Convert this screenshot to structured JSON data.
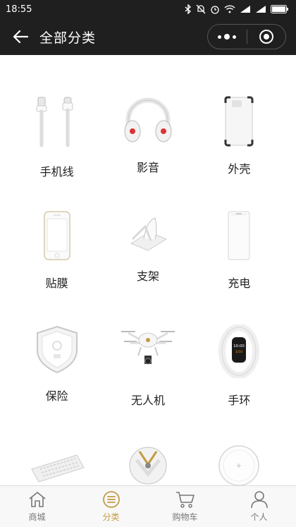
{
  "status_bar": {
    "time": "18:55"
  },
  "nav": {
    "title": "全部分类"
  },
  "categories": [
    {
      "label": "手机线",
      "icon": "cable-icon"
    },
    {
      "label": "影音",
      "icon": "headphones-icon"
    },
    {
      "label": "外壳",
      "icon": "phone-case-icon"
    },
    {
      "label": "贴膜",
      "icon": "screen-protector-icon"
    },
    {
      "label": "支架",
      "icon": "phone-stand-icon"
    },
    {
      "label": "充电",
      "icon": "power-bank-icon"
    },
    {
      "label": "保险",
      "icon": "insurance-shield-icon"
    },
    {
      "label": "无人机",
      "icon": "drone-icon"
    },
    {
      "label": "手环",
      "icon": "fitness-band-icon"
    },
    {
      "label": "",
      "icon": "keyboard-icon"
    },
    {
      "label": "",
      "icon": "speaker-icon"
    },
    {
      "label": "",
      "icon": "wireless-charger-icon"
    }
  ],
  "band_screen": {
    "line1": "10:00",
    "line2": "1/10"
  },
  "tabs": [
    {
      "label": "商城",
      "icon": "home-icon",
      "active": false
    },
    {
      "label": "分类",
      "icon": "category-icon",
      "active": true
    },
    {
      "label": "购物车",
      "icon": "cart-icon",
      "active": false
    },
    {
      "label": "个人",
      "icon": "person-icon",
      "active": false
    }
  ],
  "colors": {
    "bar": "#1f1f1f",
    "accent": "#c39b44",
    "tab_inactive": "#777777"
  }
}
